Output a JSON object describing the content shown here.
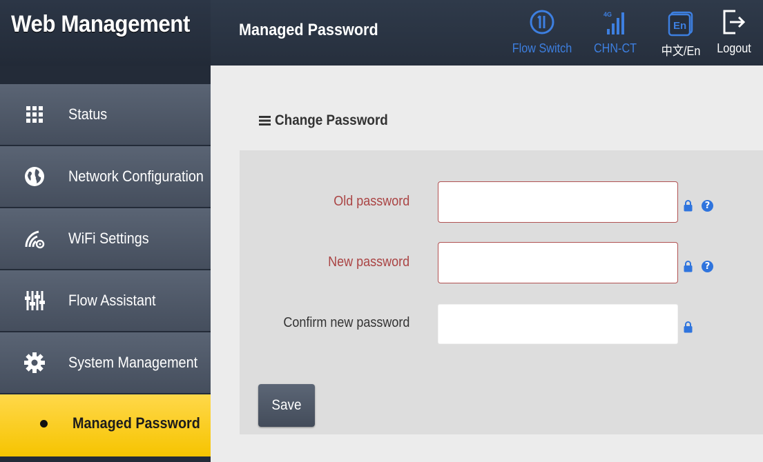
{
  "header": {
    "brand": "Web Management",
    "page_title": "Managed Password",
    "toolbar": {
      "flow_switch": "Flow Switch",
      "network": "CHN-CT",
      "network_type": "4G",
      "language": "中文/En",
      "language_icon": "En",
      "logout": "Logout"
    }
  },
  "sidebar": {
    "items": [
      {
        "label": "Status",
        "icon": "grid-icon"
      },
      {
        "label": "Network Configuration",
        "icon": "globe-icon"
      },
      {
        "label": "WiFi Settings",
        "icon": "wifi-gear-icon"
      },
      {
        "label": "Flow Assistant",
        "icon": "sliders-icon"
      },
      {
        "label": "System Management",
        "icon": "gear-icon"
      }
    ],
    "active_sub": "Managed Password"
  },
  "main": {
    "section_title": "Change Password",
    "fields": {
      "old_password": {
        "label": "Old password",
        "value": ""
      },
      "new_password": {
        "label": "New password",
        "value": ""
      },
      "confirm_password": {
        "label": "Confirm new password",
        "value": ""
      }
    },
    "help_symbol": "?",
    "save_label": "Save"
  },
  "colors": {
    "accent_blue": "#3d7fe0",
    "active_yellow": "#f6c400",
    "error_red": "#a44"
  }
}
